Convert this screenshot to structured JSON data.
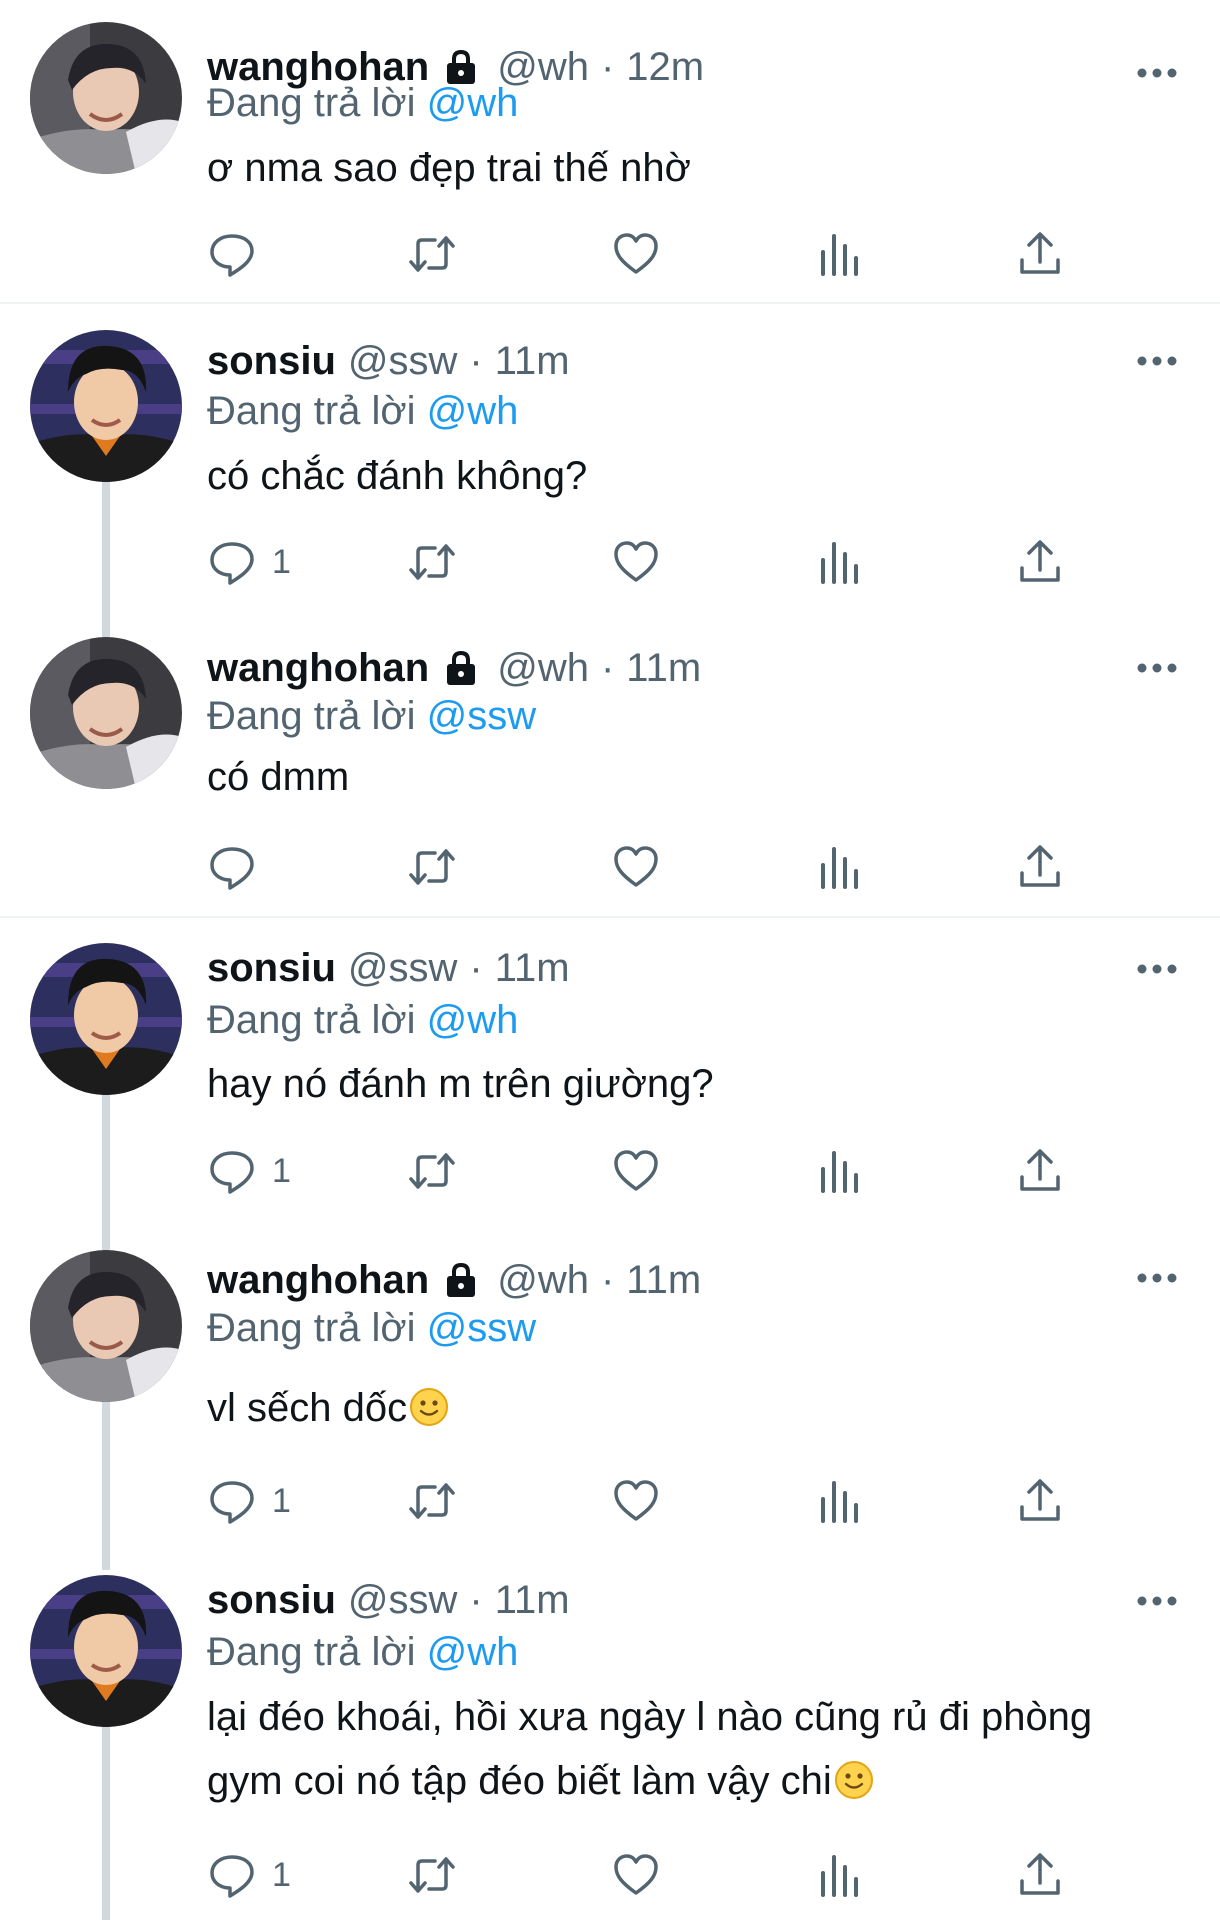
{
  "tweets": [
    {
      "name": "wanghohan",
      "handle": "@wh",
      "separator": "·",
      "time": "12m",
      "replying_prefix": "Đang trả lời",
      "replying_to": "@wh",
      "lines": [
        "ơ nma sao đẹp trai thế nhờ"
      ],
      "reply_count": "",
      "protected": true
    },
    {
      "name": "sonsiu",
      "handle": "@ssw",
      "separator": "·",
      "time": "11m",
      "replying_prefix": "Đang trả lời",
      "replying_to": "@wh",
      "lines": [
        "có chắc đánh không?"
      ],
      "reply_count": "1",
      "protected": false
    },
    {
      "name": "wanghohan",
      "handle": "@wh",
      "separator": "·",
      "time": "11m",
      "replying_prefix": "Đang trả lời",
      "replying_to": "@ssw",
      "lines": [
        "có dmm"
      ],
      "reply_count": "",
      "protected": true
    },
    {
      "name": "sonsiu",
      "handle": "@ssw",
      "separator": "·",
      "time": "11m",
      "replying_prefix": "Đang trả lời",
      "replying_to": "@wh",
      "lines": [
        "hay nó đánh m trên giường?"
      ],
      "reply_count": "1",
      "protected": false
    },
    {
      "name": "wanghohan",
      "handle": "@wh",
      "separator": "·",
      "time": "11m",
      "replying_prefix": "Đang trả lời",
      "replying_to": "@ssw",
      "lines": [
        "vl sếch dốc"
      ],
      "reply_count": "1",
      "protected": true
    },
    {
      "name": "sonsiu",
      "handle": "@ssw",
      "separator": "·",
      "time": "11m",
      "replying_prefix": "Đang trả lời",
      "replying_to": "@wh",
      "lines": [
        "lại đéo khoái, hồi xưa ngày l nào cũng rủ đi phòng",
        "gym coi nó tập đéo biết làm vậy chi"
      ],
      "reply_count": "1",
      "protected": false
    }
  ],
  "icons": {
    "protected": "lock-icon",
    "more": "more-icon",
    "reply": "reply-icon",
    "retweet": "retweet-icon",
    "like": "like-icon",
    "views": "views-icon",
    "share": "share-icon",
    "emoji": "slightly-smiling-face-emoji"
  },
  "colors": {
    "text": "#0f1419",
    "secondary": "#536471",
    "mention": "#1d9bf0",
    "thread_line": "#cfd9de",
    "divider": "#eff3f4"
  }
}
